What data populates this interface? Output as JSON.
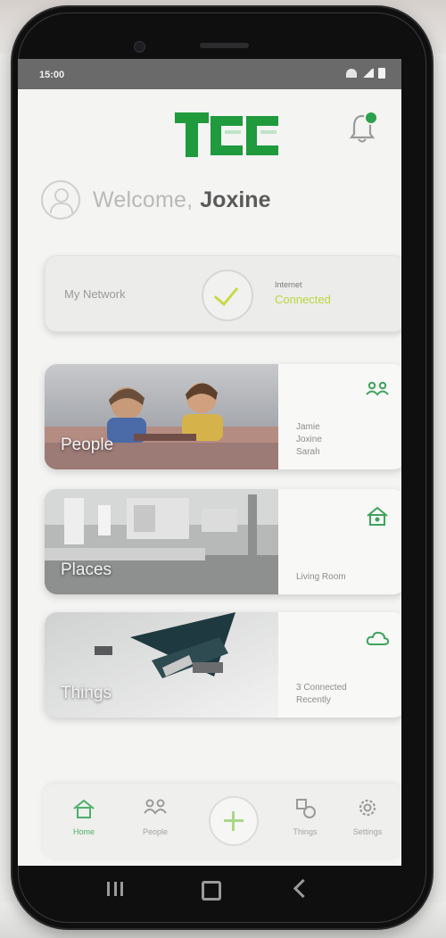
{
  "status_bar": {
    "time": "15:00"
  },
  "header": {
    "logo_text": "TCC",
    "has_notification": true
  },
  "welcome": {
    "greeting": "Welcome,",
    "name": "Joxine"
  },
  "network": {
    "label": "My Network",
    "small_label": "Internet",
    "status": "Connected"
  },
  "cards": [
    {
      "title": "People",
      "icon": "people-icon",
      "items": [
        "Jamie",
        "Joxine",
        "Sarah"
      ]
    },
    {
      "title": "Places",
      "icon": "home-icon",
      "items": [
        "Living Room"
      ]
    },
    {
      "title": "Things",
      "icon": "cloud-icon",
      "items": [
        "3 Connected",
        "Recently"
      ]
    }
  ],
  "bottom_nav": [
    {
      "label": "Home",
      "icon": "home-icon",
      "active": true
    },
    {
      "label": "People",
      "icon": "people-icon",
      "active": false
    },
    {
      "label": "Add",
      "icon": "plus-icon",
      "active": false
    },
    {
      "label": "Things",
      "icon": "things-icon",
      "active": false
    },
    {
      "label": "Settings",
      "icon": "gear-icon",
      "active": false
    }
  ],
  "colors": {
    "brand_green": "#1f9a3c",
    "accent_lime": "#b9d63e",
    "nav_active": "#4caf6a"
  }
}
